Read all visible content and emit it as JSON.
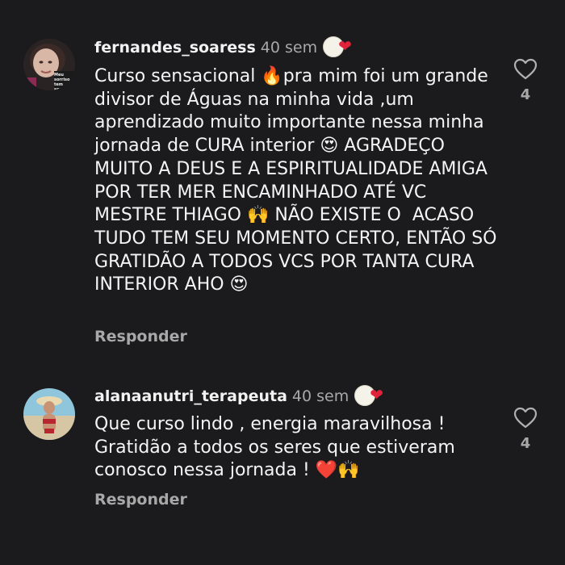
{
  "comments": [
    {
      "username": "fernandes_soaress",
      "time": "40 sem",
      "text": "Curso sensacional 🔥pra mim foi um grande divisor de Águas na minha vida ,um aprendizado muito importante nessa minha jornada de CURA interior 😍 AGRADEÇO MUITO A DEUS E A ESPIRITUALIDADE AMIGA POR TER MER ENCAMINHADO ATÉ VC MESTRE THIAGO 🙌 NÃO EXISTE O  ACASO TUDO TEM SEU MOMENTO CERTO, ENTÃO SÓ GRATIDÃO A TODOS VCS POR TANTA CURA INTERIOR AHO 😍",
      "reply_label": "Responder",
      "like_count": "4",
      "avatar_caption": "Meu sorriso tem seu nome",
      "badge_icon": "heart-icon"
    },
    {
      "username": "alanaanutri_terapeuta",
      "time": "40 sem",
      "text": "Que curso lindo , energia maravilhosa ! Gratidão a todos os seres que estiveram conosco nessa jornada ! ❤️🙌",
      "reply_label": "Responder",
      "like_count": "4",
      "badge_icon": "heart-icon"
    }
  ],
  "colors": {
    "background": "#1b1b1d",
    "text": "#f4f4f4",
    "muted": "#a8a8a8",
    "heart": "#e0233a"
  }
}
